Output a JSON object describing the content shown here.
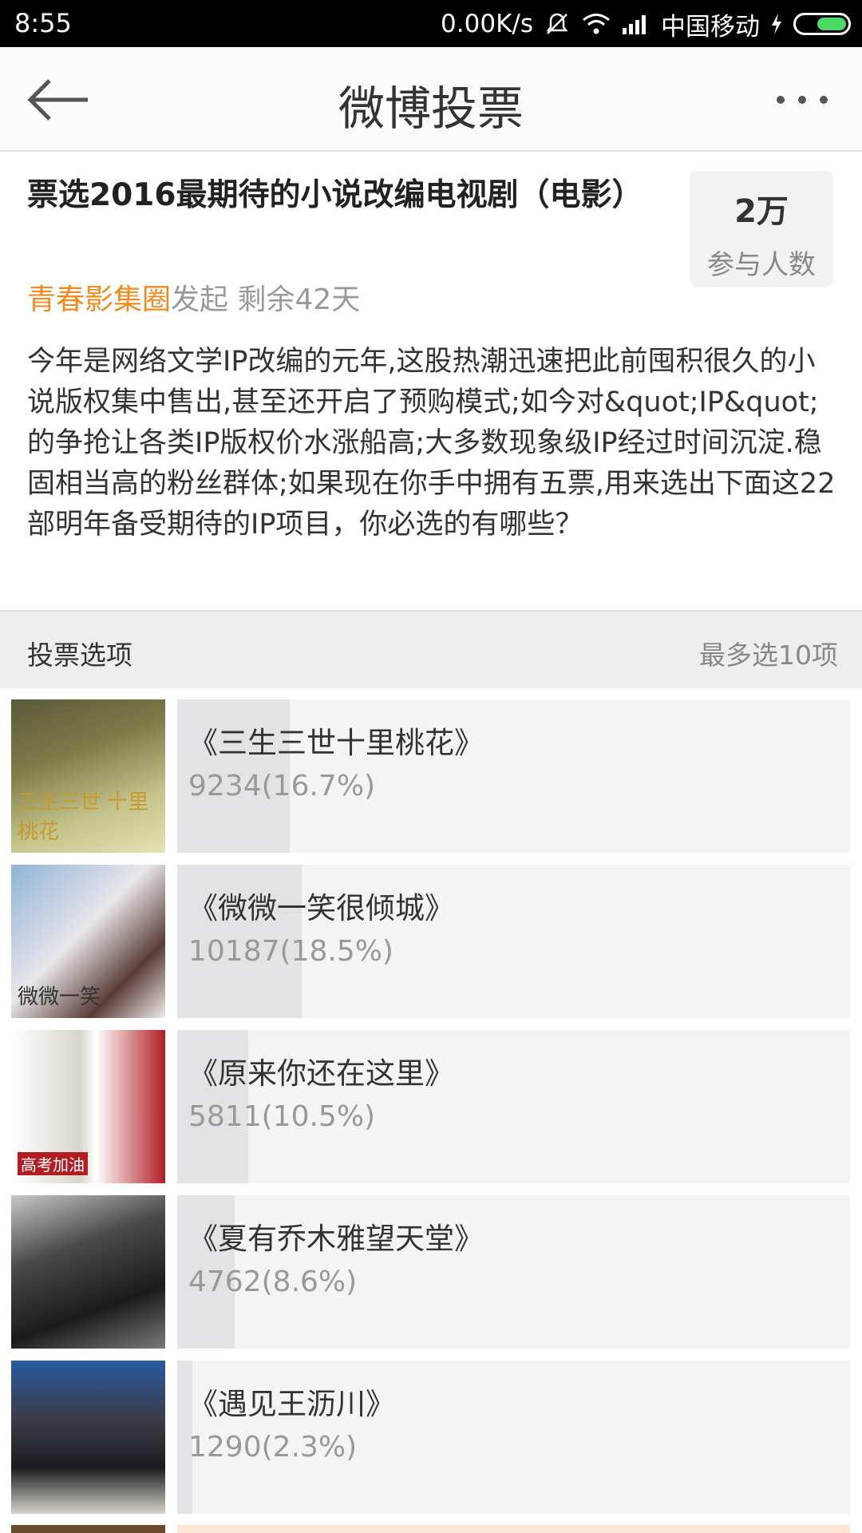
{
  "status_bar": {
    "time": "8:55",
    "network_speed": "0.00K/s",
    "carrier": "中国移动",
    "icons": [
      "mute-icon",
      "wifi-icon",
      "signal-icon",
      "charging-icon",
      "battery-icon"
    ]
  },
  "nav": {
    "title": "微博投票",
    "back_icon": "arrow-left-icon",
    "more_icon": "more-dots-icon"
  },
  "poll": {
    "title": "票选2016最期待的小说改编电视剧（电影）",
    "participants_count": "2万",
    "participants_label": "参与人数",
    "author": "青春影集圈",
    "initiated": "发起",
    "remaining": "剩余42天",
    "description": "今年是网络文学IP改编的元年,这股热潮迅速把此前囤积很久的小说版权集中售出,甚至还开启了预购模式;如今对&quot;IP&quot;的争抢让各类IP版权价水涨船高;大多数现象级IP经过时间沉淀.稳固相当高的粉丝群体;如果现在你手中拥有五票,用来选出下面这22部明年备受期待的IP项目，你必选的有哪些？"
  },
  "options_header": {
    "label": "投票选项",
    "limit": "最多选10项"
  },
  "options": [
    {
      "name": "《三生三世十里桃花》",
      "count": "9234(16.7%)",
      "percent": 16.7,
      "thumb_caption": "三生三世 十里桃花"
    },
    {
      "name": "《微微一笑很倾城》",
      "count": "10187(18.5%)",
      "percent": 18.5,
      "thumb_caption": "微微一笑"
    },
    {
      "name": "《原来你还在这里》",
      "count": "5811(10.5%)",
      "percent": 10.5,
      "thumb_caption": "高考加油"
    },
    {
      "name": "《夏有乔木雅望天堂》",
      "count": "4762(8.6%)",
      "percent": 8.6,
      "thumb_caption": ""
    },
    {
      "name": "《遇见王沥川》",
      "count": "1290(2.3%)",
      "percent": 2.3,
      "thumb_caption": ""
    }
  ]
}
